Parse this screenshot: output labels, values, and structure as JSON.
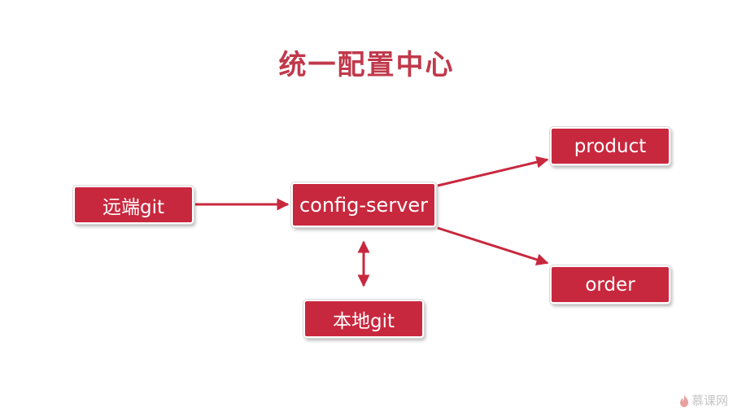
{
  "title": "统一配置中心",
  "nodes": {
    "remote_git": "远端git",
    "config_server": "config-server",
    "product": "product",
    "order": "order",
    "local_git": "本地git"
  },
  "watermark": {
    "text": "慕课网",
    "icon": "flame-icon"
  },
  "colors": {
    "title": "#c0394b",
    "node_fill": "#c8283e",
    "arrow": "#c8283e",
    "watermark": "#c6c6c6"
  }
}
